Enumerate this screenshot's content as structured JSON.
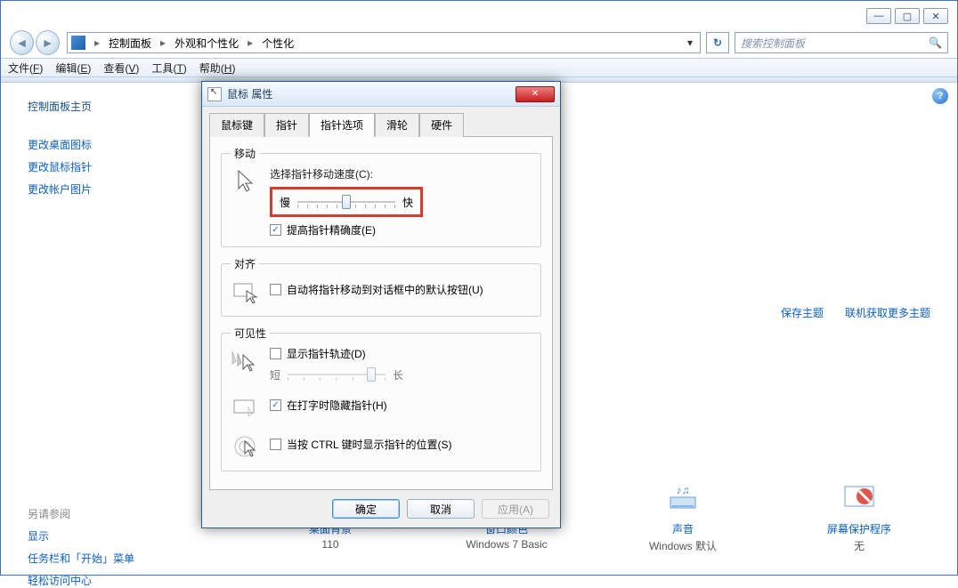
{
  "window_controls": {
    "min": "—",
    "max": "▢",
    "close": "✕"
  },
  "breadcrumbs": [
    "控制面板",
    "外观和个性化",
    "个性化"
  ],
  "search_placeholder": "搜索控制面板",
  "menubar": [
    {
      "label": "文件",
      "key": "F"
    },
    {
      "label": "编辑",
      "key": "E"
    },
    {
      "label": "查看",
      "key": "V"
    },
    {
      "label": "工具",
      "key": "T"
    },
    {
      "label": "帮助",
      "key": "H"
    }
  ],
  "sidebar": {
    "heading": "控制面板主页",
    "links": [
      "更改桌面图标",
      "更改鼠标指针",
      "更改帐户图片"
    ],
    "also_label": "另请参阅",
    "also_links": [
      "显示",
      "任务栏和「开始」菜单",
      "轻松访问中心"
    ]
  },
  "content_links": {
    "save_theme": "保存主题",
    "more_themes": "联机获取更多主题"
  },
  "bottom_items": [
    {
      "title": "桌面背景",
      "sub": "110",
      "icon": "black"
    },
    {
      "title": "窗口颜色",
      "sub": "Windows 7 Basic",
      "icon": "wcolor"
    },
    {
      "title": "声音",
      "sub": "Windows 默认",
      "icon": "sound"
    },
    {
      "title": "屏幕保护程序",
      "sub": "无",
      "icon": "ssaver"
    }
  ],
  "dialog": {
    "title": "鼠标 属性",
    "tabs": [
      "鼠标键",
      "指针",
      "指针选项",
      "滑轮",
      "硬件"
    ],
    "active_tab": 2,
    "movement": {
      "group_label": "移动",
      "speed_label": "选择指针移动速度(C):",
      "slow": "慢",
      "fast": "快",
      "enhance": "提高指针精确度(E)",
      "enhance_checked": true
    },
    "snap": {
      "group_label": "对齐",
      "snap_label": "自动将指针移动到对话框中的默认按钮(U)",
      "checked": false
    },
    "visibility": {
      "group_label": "可见性",
      "trail_label": "显示指针轨迹(D)",
      "trail_checked": false,
      "short": "短",
      "long": "长",
      "hide_label": "在打字时隐藏指针(H)",
      "hide_checked": true,
      "ctrl_label": "当按 CTRL 键时显示指针的位置(S)",
      "ctrl_checked": false
    },
    "buttons": {
      "ok": "确定",
      "cancel": "取消",
      "apply": "应用(A)"
    }
  }
}
